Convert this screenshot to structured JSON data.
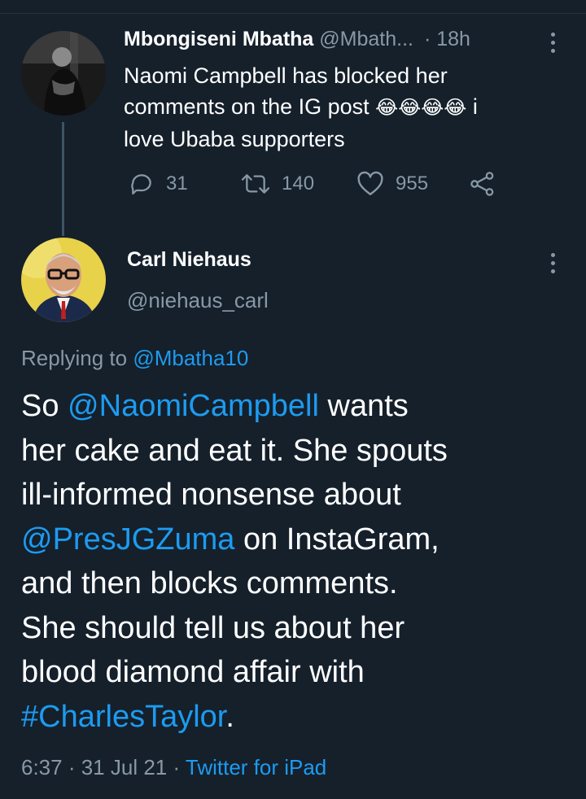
{
  "reply_tweet": {
    "author_name": "Mbongiseni Mbatha",
    "handle": "@Mbath...",
    "time": "· 18h",
    "text_line1": "Naomi Campbell has blocked her",
    "text_line2_pre": "comments on the IG post",
    "text_line2_emoji": "😂😂😂😂",
    "text_line2_post": " i",
    "text_line3": "love Ubaba supporters",
    "replies": "31",
    "retweets": "140",
    "likes": "955"
  },
  "main_tweet": {
    "author_name": "Carl Niehaus",
    "handle": "@niehaus_carl",
    "replying_label": "Replying to",
    "replying_handle": "@Mbatha10",
    "text": {
      "w1": "So ",
      "m1": "@NaomiCampbell",
      "w2": " wants",
      "l2": "her cake and eat it. She spouts",
      "l3": "ill-informed nonsense about",
      "m2": "@PresJGZuma",
      "w3": " on InstaGram,",
      "l5": "and then blocks comments.",
      "l6": "She should tell us about her",
      "l7": "blood diamond affair with",
      "h1": "#CharlesTaylor",
      "w4": "."
    },
    "footer_time": "6:37 · 31 Jul 21 · ",
    "footer_source": "Twitter for iPad"
  },
  "icons": [
    "reply-icon",
    "retweet-icon",
    "like-icon",
    "share-icon",
    "more-options-icon"
  ],
  "colors": {
    "background": "#15202b",
    "accent": "#1d9bf0",
    "muted": "#8899a6",
    "text": "#ffffff"
  }
}
